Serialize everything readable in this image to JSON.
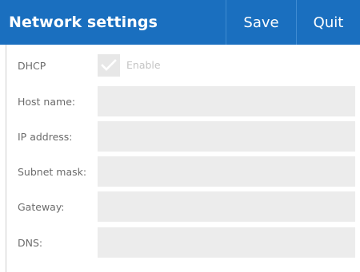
{
  "window": {
    "title": "Network settings",
    "save_label": "Save",
    "quit_label": "Quit"
  },
  "form": {
    "dhcp": {
      "label": "DHCP",
      "checkbox_label": "Enable",
      "checked": true,
      "disabled": true
    },
    "fields": [
      {
        "label": "Host name:",
        "value": "",
        "placeholder": ""
      },
      {
        "label": "IP address:",
        "value": "",
        "placeholder": ""
      },
      {
        "label": "Subnet mask:",
        "value": "",
        "placeholder": ""
      },
      {
        "label": "Gateway:",
        "value": "",
        "placeholder": ""
      },
      {
        "label": "DNS:",
        "value": "",
        "placeholder": ""
      }
    ]
  },
  "icons": {
    "checkbox_check": "checkmark-icon"
  },
  "colors": {
    "header_background": "#1a6fbf",
    "header_text": "#ffffff",
    "field_background": "#ececec",
    "label_text": "#6b6b6b",
    "disabled_text": "#c4c4c4"
  }
}
